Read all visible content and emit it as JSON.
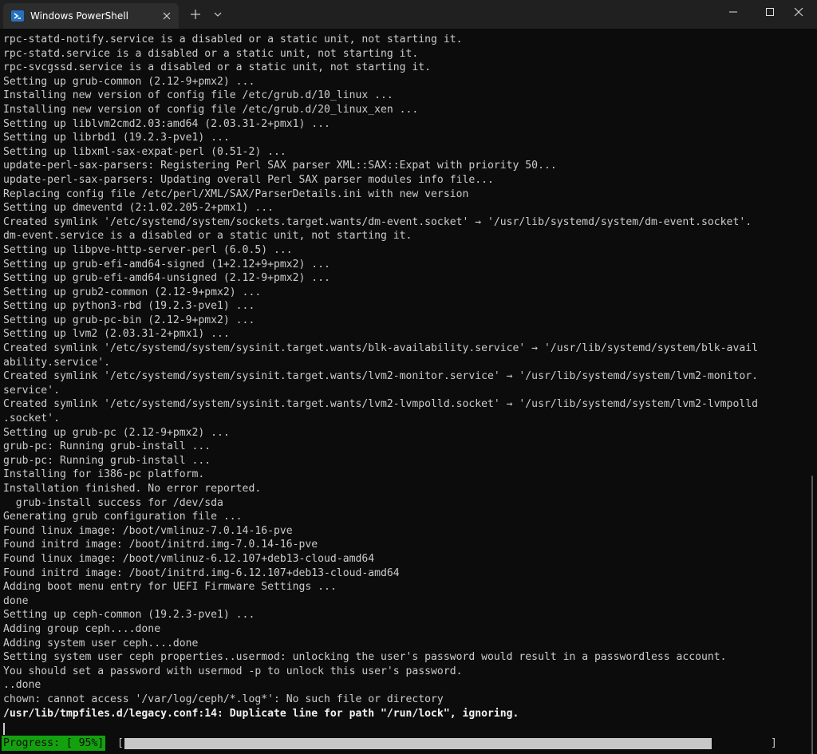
{
  "window": {
    "tab_title": "Windows PowerShell",
    "tab_icon": "powershell-icon",
    "close_tab_icon": "close-icon",
    "new_tab_icon": "plus-icon",
    "dropdown_icon": "chevron-down-icon",
    "minimize_icon": "minimize-icon",
    "maximize_icon": "maximize-icon",
    "close_window_icon": "close-icon"
  },
  "terminal": {
    "lines": [
      "rpc-statd-notify.service is a disabled or a static unit, not starting it.",
      "rpc-statd.service is a disabled or a static unit, not starting it.",
      "rpc-svcgssd.service is a disabled or a static unit, not starting it.",
      "Setting up grub-common (2.12-9+pmx2) ...",
      "Installing new version of config file /etc/grub.d/10_linux ...",
      "Installing new version of config file /etc/grub.d/20_linux_xen ...",
      "Setting up liblvm2cmd2.03:amd64 (2.03.31-2+pmx1) ...",
      "Setting up librbd1 (19.2.3-pve1) ...",
      "Setting up libxml-sax-expat-perl (0.51-2) ...",
      "update-perl-sax-parsers: Registering Perl SAX parser XML::SAX::Expat with priority 50...",
      "update-perl-sax-parsers: Updating overall Perl SAX parser modules info file...",
      "Replacing config file /etc/perl/XML/SAX/ParserDetails.ini with new version",
      "Setting up dmeventd (2:1.02.205-2+pmx1) ...",
      "Created symlink '/etc/systemd/system/sockets.target.wants/dm-event.socket' → '/usr/lib/systemd/system/dm-event.socket'.",
      "dm-event.service is a disabled or a static unit, not starting it.",
      "Setting up libpve-http-server-perl (6.0.5) ...",
      "Setting up grub-efi-amd64-signed (1+2.12+9+pmx2) ...",
      "Setting up grub-efi-amd64-unsigned (2.12-9+pmx2) ...",
      "Setting up grub2-common (2.12-9+pmx2) ...",
      "Setting up python3-rbd (19.2.3-pve1) ...",
      "Setting up grub-pc-bin (2.12-9+pmx2) ...",
      "Setting up lvm2 (2.03.31-2+pmx1) ...",
      "Created symlink '/etc/systemd/system/sysinit.target.wants/blk-availability.service' → '/usr/lib/systemd/system/blk-avail",
      "ability.service'.",
      "Created symlink '/etc/systemd/system/sysinit.target.wants/lvm2-monitor.service' → '/usr/lib/systemd/system/lvm2-monitor.",
      "service'.",
      "Created symlink '/etc/systemd/system/sysinit.target.wants/lvm2-lvmpolld.socket' → '/usr/lib/systemd/system/lvm2-lvmpolld",
      ".socket'.",
      "Setting up grub-pc (2.12-9+pmx2) ...",
      "grub-pc: Running grub-install ...",
      "grub-pc: Running grub-install ...",
      "Installing for i386-pc platform.",
      "Installation finished. No error reported.",
      "  grub-install success for /dev/sda",
      "Generating grub configuration file ...",
      "Found linux image: /boot/vmlinuz-7.0.14-16-pve",
      "Found initrd image: /boot/initrd.img-7.0.14-16-pve",
      "Found linux image: /boot/vmlinuz-6.12.107+deb13-cloud-amd64",
      "Found initrd image: /boot/initrd.img-6.12.107+deb13-cloud-amd64",
      "Adding boot menu entry for UEFI Firmware Settings ...",
      "done",
      "Setting up ceph-common (19.2.3-pve1) ...",
      "Adding group ceph....done",
      "Adding system user ceph....done",
      "Setting system user ceph properties..usermod: unlocking the user's password would result in a passwordless account.",
      "You should set a password with usermod -p to unlock this user's password.",
      "..done",
      "chown: cannot access '/var/log/ceph/*.log*': No such file or directory",
      "/usr/lib/tmpfiles.d/legacy.conf:14: Duplicate line for path \"/run/lock\", ignoring."
    ]
  },
  "status": {
    "progress_label": "Progress: [ 95%]",
    "bracket_open": "[",
    "bracket_close": "]",
    "progress_fraction": 0.95,
    "progress_color": "#13a10e"
  }
}
